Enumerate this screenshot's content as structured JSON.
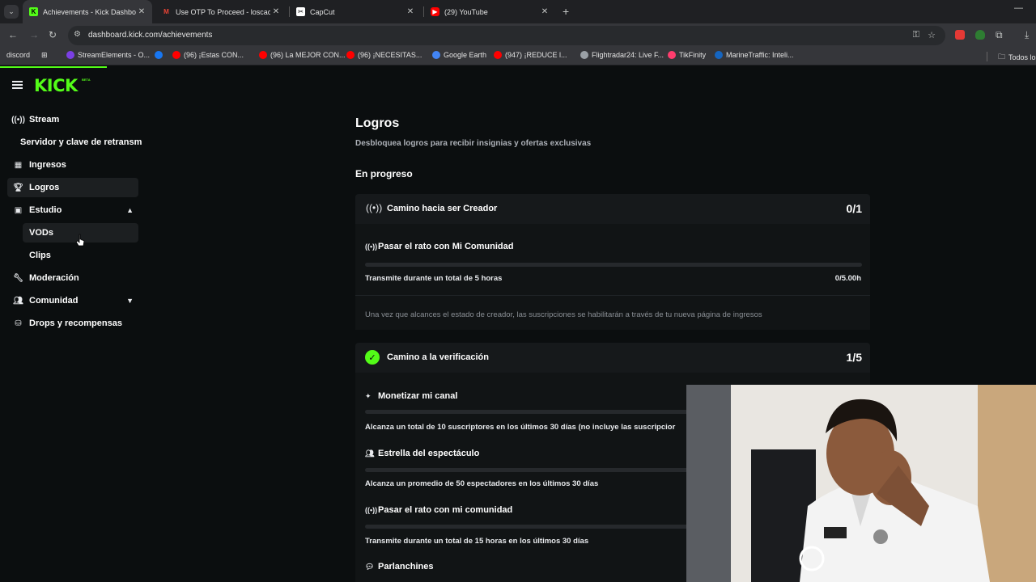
{
  "browser": {
    "tabs": [
      {
        "title": "Achievements - Kick Dashboard",
        "favicon": "kick-icon",
        "active": true
      },
      {
        "title": "Use OTP To Proceed - loscacho",
        "favicon": "gmail-icon",
        "active": false
      },
      {
        "title": "CapCut",
        "favicon": "capcut-icon",
        "active": false
      },
      {
        "title": "(29) YouTube",
        "favicon": "youtube-icon",
        "active": false
      }
    ],
    "url": "dashboard.kick.com/achievements",
    "bookmarks": [
      "discord",
      "StreamElements - O...",
      "(96) ¡Estas CON...",
      "(96) La MEJOR CON...",
      "(96) ¡NECESITAS...",
      "Google Earth",
      "(947) ¡REDUCE l...",
      "Flightradar24: Live F...",
      "TikFinity",
      "MarineTraffic: Inteli...",
      "Todos los"
    ]
  },
  "sidebar": {
    "logo": "KICK",
    "logo_badge": "BETA",
    "items": [
      {
        "label": "Stream",
        "icon": "broadcast-icon"
      },
      {
        "label": "Servidor y clave de retransm",
        "icon": ""
      },
      {
        "label": "Ingresos",
        "icon": "chart-icon"
      },
      {
        "label": "Logros",
        "icon": "trophy-icon",
        "active": true
      },
      {
        "label": "Estudio",
        "icon": "studio-icon",
        "expanded": true
      },
      {
        "label": "VODs",
        "icon": ""
      },
      {
        "label": "Clips",
        "icon": ""
      },
      {
        "label": "Moderación",
        "icon": "wrench-icon"
      },
      {
        "label": "Comunidad",
        "icon": "people-icon",
        "expanded": false
      },
      {
        "label": "Drops y recompensas",
        "icon": "gift-icon"
      }
    ]
  },
  "main": {
    "title": "Logros",
    "subtitle": "Desbloquea logros para recibir insignias y ofertas exclusivas",
    "section": "En progreso",
    "cards": [
      {
        "title": "Camino hacia ser Creador",
        "count": "0/1",
        "tasks": [
          {
            "title": "Pasar el rato con Mi Comunidad",
            "desc": "Transmite durante un total de 5 horas",
            "value": "0/5.00h",
            "progress": 0
          }
        ],
        "note": "Una vez que alcances el estado de creador, las suscripciones se habilitarán a través de tu nueva página de ingresos"
      },
      {
        "title": "Camino a la verificación",
        "count": "1/5",
        "tasks": [
          {
            "title": "Monetizar mi canal",
            "desc": "Alcanza un total de 10 suscriptores en los últimos 30 días (no incluye las suscripcior",
            "progress": 0
          },
          {
            "title": "Estrella del espectáculo",
            "desc": "Alcanza un promedio de 50 espectadores en los últimos 30 días",
            "progress": 0
          },
          {
            "title": "Pasar el rato con mi comunidad",
            "desc": "Transmite durante un total de 15 horas en los últimos 30 días",
            "progress": 0
          },
          {
            "title": "Parlanchines"
          }
        ]
      }
    ]
  },
  "colors": {
    "accent": "#53fc18",
    "background": "#0b0e0f",
    "card": "#16191b"
  }
}
